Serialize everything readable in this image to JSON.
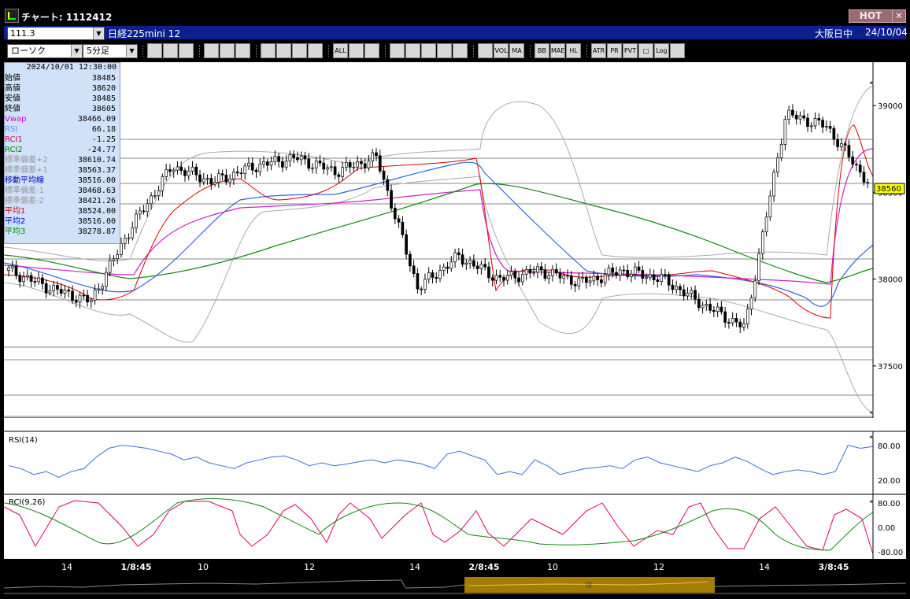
{
  "window": {
    "title": "チャート: 1112412",
    "hot_label": "HOT",
    "close_label": "✕"
  },
  "symbol": {
    "code": "111.3",
    "name": "日経225mini 12",
    "exchange": "大阪日中",
    "date": "24/10/04"
  },
  "toolbar": {
    "chart_type": "ローソク",
    "interval": "5分足",
    "icons": [
      "zoom-icon",
      "range-icon",
      "pencil-icon",
      "line-icon",
      "pointer-icon",
      "undo-icon",
      "sheet-icon",
      "trash-icon",
      "candle-a-icon",
      "candle-b-icon",
      "all-icon",
      "dog-icon",
      "search-icon",
      "bar-icon",
      "arrow-icon",
      "blank-icon",
      "settings-icon",
      "wrench-icon",
      "color-icon",
      "vol-icon",
      "ma-icon",
      "bb-icon",
      "mae-icon",
      "hl-icon",
      "atr-icon",
      "pr-icon",
      "pvt-icon",
      "box-icon",
      "log-icon",
      "export-icon"
    ],
    "icon_labels": [
      "",
      "",
      "",
      "",
      "",
      "",
      "",
      "",
      "",
      "",
      "ALL",
      "",
      "",
      "",
      "",
      "",
      "",
      "",
      "",
      "VOL",
      "MA",
      "BB",
      "MAE",
      "HL",
      "ATR",
      "PR",
      "PVT",
      "□",
      "Log",
      ""
    ]
  },
  "info": {
    "datetime": "2024/10/01 12:30:00",
    "rows": [
      {
        "label": "始値",
        "value": "38485",
        "color": "#000000"
      },
      {
        "label": "高値",
        "value": "38620",
        "color": "#000000"
      },
      {
        "label": "安値",
        "value": "38485",
        "color": "#000000"
      },
      {
        "label": "終値",
        "value": "38605",
        "color": "#000000"
      },
      {
        "label": "Vwap",
        "value": "38466.09",
        "color": "#dd00dd"
      },
      {
        "label": "RSI",
        "value": "66.18",
        "color": "#6688ff"
      },
      {
        "label": "RCI1",
        "value": "-1.25",
        "color": "#dd0066"
      },
      {
        "label": "RCI2",
        "value": "-24.77",
        "color": "#008800"
      },
      {
        "label": "標準偏差+2",
        "value": "38610.74",
        "color": "#999999"
      },
      {
        "label": "標準偏差+1",
        "value": "38563.37",
        "color": "#999999"
      },
      {
        "label": "移動平均線",
        "value": "38516.00",
        "color": "#0000bb"
      },
      {
        "label": "標準偏差-1",
        "value": "38468.63",
        "color": "#999999"
      },
      {
        "label": "標準偏差-2",
        "value": "38421.26",
        "color": "#999999"
      },
      {
        "label": "平均1",
        "value": "38524.00",
        "color": "#dd0000"
      },
      {
        "label": "平均2",
        "value": "38516.00",
        "color": "#0000dd"
      },
      {
        "label": "平均3",
        "value": "38278.87",
        "color": "#008800"
      }
    ]
  },
  "chart_data": [
    {
      "type": "candlestick",
      "y_ticks": [
        "39000",
        "38500",
        "38000",
        "37500"
      ],
      "ylim": [
        37200,
        39250
      ],
      "last_price": "38560",
      "x_ticks": [
        "14",
        "1/8:45",
        "10",
        "12",
        "14",
        "2/8:45",
        "10",
        "12",
        "14",
        "3/8:45"
      ],
      "key_closes": [
        38050,
        37950,
        37870,
        38300,
        38650,
        38560,
        38650,
        38700,
        38620,
        38700,
        37950,
        38130,
        38000,
        38050,
        37980,
        38050,
        38000,
        37850,
        37720,
        38950,
        38880,
        38560
      ],
      "series": [
        {
          "name": "移動平均線",
          "color": "#2f66d6"
        },
        {
          "name": "Vwap",
          "color": "#d020d0"
        },
        {
          "name": "平均1",
          "color": "#dd0000"
        },
        {
          "name": "平均3",
          "color": "#118811"
        },
        {
          "name": "標準偏差",
          "color": "#aaaaaa"
        }
      ]
    },
    {
      "type": "line",
      "title": "RSI(14)",
      "y_ticks": [
        "80.00",
        "20.00"
      ],
      "ylim": [
        0,
        100
      ],
      "values": [
        45,
        40,
        30,
        35,
        25,
        35,
        40,
        60,
        75,
        80,
        78,
        75,
        70,
        65,
        55,
        60,
        50,
        45,
        40,
        50,
        55,
        60,
        62,
        55,
        45,
        50,
        45,
        48,
        52,
        55,
        50,
        55,
        52,
        48,
        40,
        65,
        70,
        62,
        55,
        30,
        35,
        30,
        55,
        45,
        30,
        35,
        40,
        42,
        45,
        40,
        55,
        60,
        50,
        45,
        40,
        35,
        45,
        50,
        60,
        52,
        40,
        30,
        35,
        38,
        35,
        30,
        35,
        80,
        75,
        78
      ],
      "color": "#3a6fd8"
    },
    {
      "type": "line",
      "title": "RCI(9,26)",
      "y_ticks": [
        "80.00",
        "0.00",
        "-80.00"
      ],
      "ylim": [
        -100,
        100
      ],
      "series": [
        {
          "name": "RCI1",
          "color": "#dd0066"
        },
        {
          "name": "RCI2",
          "color": "#118811"
        }
      ]
    }
  ]
}
